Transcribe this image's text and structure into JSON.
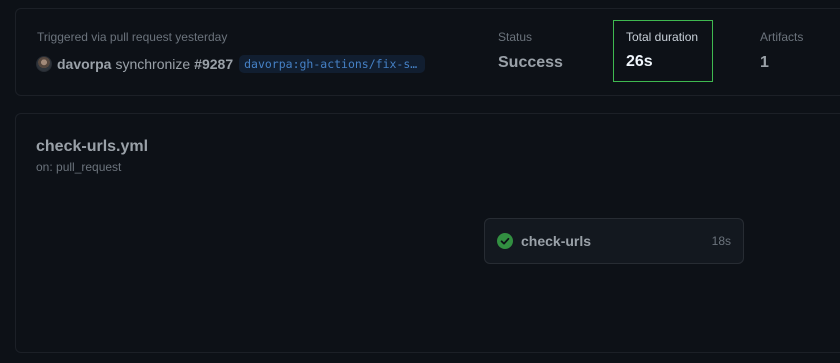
{
  "summary": {
    "trigger_text": "Triggered via pull request yesterday",
    "actor": "davorpa",
    "event": "synchronize",
    "pr_number": "#9287",
    "branch": "davorpa:gh-actions/fix-se…",
    "status_label": "Status",
    "status_value": "Success",
    "duration_label": "Total duration",
    "duration_value": "26s",
    "artifacts_label": "Artifacts",
    "artifacts_value": "1"
  },
  "workflow": {
    "file_name": "check-urls.yml",
    "trigger": "on: pull_request",
    "jobs": [
      {
        "name": "check-urls",
        "duration": "18s",
        "status": "success",
        "status_icon": "check-circle-fill-icon"
      }
    ]
  },
  "colors": {
    "background": "#0d1117",
    "success_green": "#3fb950",
    "link_blue": "#58a6ff",
    "border": "#30363d"
  }
}
